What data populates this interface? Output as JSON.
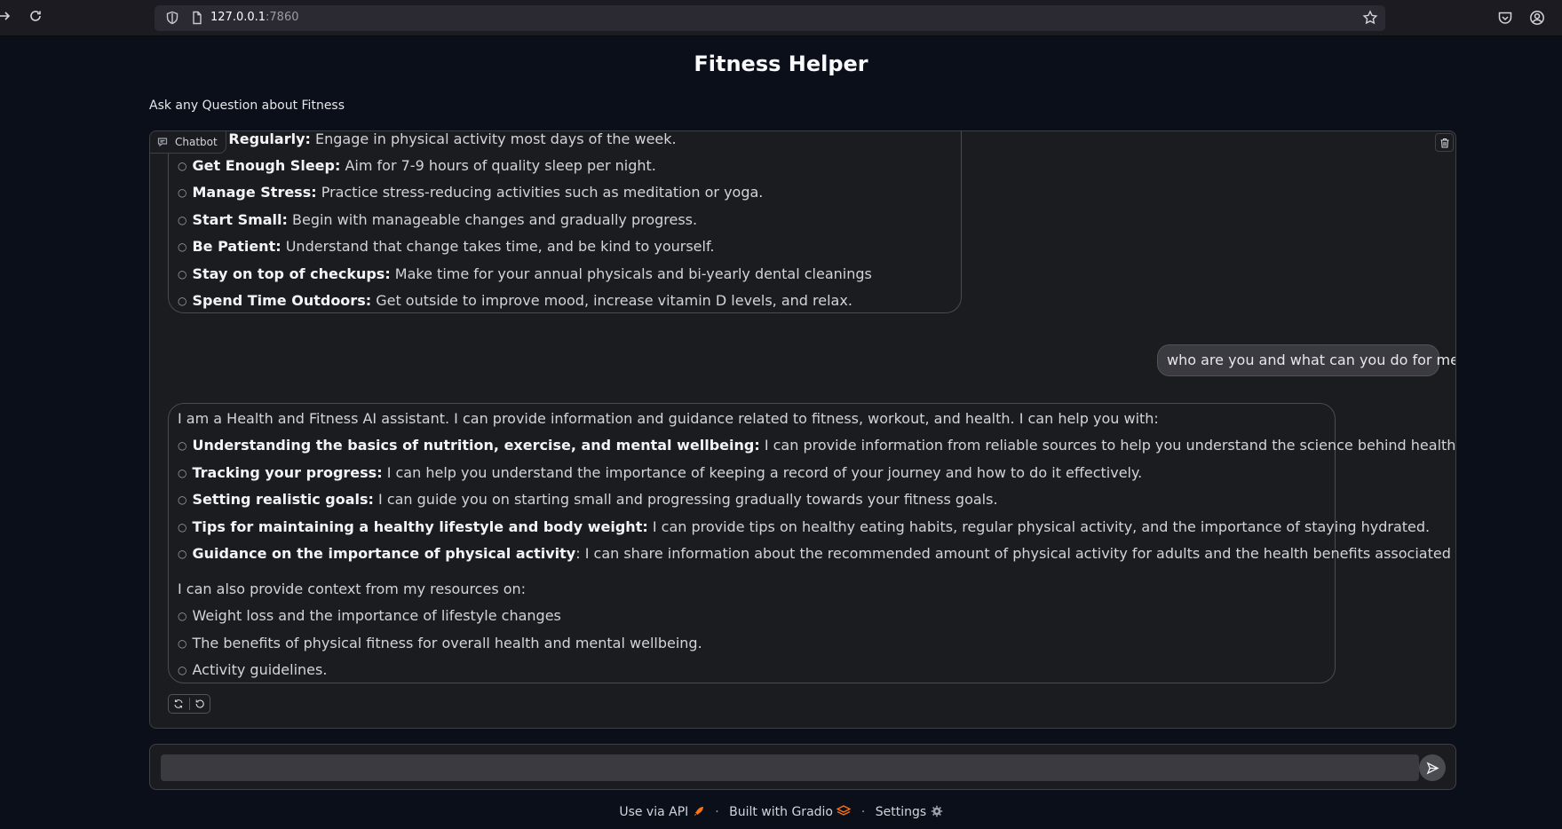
{
  "browser": {
    "url_host": "127.0.0.1",
    "url_port": ":7860"
  },
  "app": {
    "title": "Fitness Helper",
    "description": "Ask any Question about Fitness"
  },
  "chatbot": {
    "label": "Chatbot",
    "messages": [
      {
        "role": "bot",
        "items": [
          {
            "bold": "cise Regularly:",
            "text": " Engage in physical activity most days of the week."
          },
          {
            "bold": "Get Enough Sleep:",
            "text": " Aim for 7-9 hours of quality sleep per night."
          },
          {
            "bold": "Manage Stress:",
            "text": " Practice stress-reducing activities such as meditation or yoga."
          },
          {
            "bold": "Start Small:",
            "text": " Begin with manageable changes and gradually progress."
          },
          {
            "bold": "Be Patient:",
            "text": " Understand that change takes time, and be kind to yourself."
          },
          {
            "bold": "Stay on top of checkups:",
            "text": " Make time for your annual physicals and bi-yearly dental cleanings"
          },
          {
            "bold": "Spend Time Outdoors:",
            "text": " Get outside to improve mood, increase vitamin D levels, and relax."
          }
        ]
      },
      {
        "role": "user",
        "text": "who are you and what can you do for me?"
      },
      {
        "role": "bot",
        "intro": "I am a Health and Fitness AI assistant. I can provide information and guidance related to fitness, workout, and health. I can help you with:",
        "items": [
          {
            "bold": "Understanding the basics of nutrition, exercise, and mental wellbeing:",
            "text": " I can provide information from reliable sources to help you understand the science behind healthy living."
          },
          {
            "bold": "Tracking your progress:",
            "text": " I can help you understand the importance of keeping a record of your journey and how to do it effectively."
          },
          {
            "bold": "Setting realistic goals:",
            "text": " I can guide you on starting small and progressing gradually towards your fitness goals."
          },
          {
            "bold": "Tips for maintaining a healthy lifestyle and body weight:",
            "text": " I can provide tips on healthy eating habits, regular physical activity, and the importance of staying hydrated."
          },
          {
            "bold": "Guidance on the importance of physical activity",
            "text": ": I can share information about the recommended amount of physical activity for adults and the health benefits associated with it."
          }
        ],
        "outro": "I can also provide context from my resources on:",
        "items2": [
          {
            "text": "Weight loss and the importance of lifestyle changes"
          },
          {
            "text": "The benefits of physical fitness for overall health and mental wellbeing."
          },
          {
            "text": "Activity guidelines."
          }
        ]
      }
    ]
  },
  "input": {
    "value": "",
    "placeholder": ""
  },
  "footer": {
    "api_label": "Use via API",
    "built_label": "Built with Gradio",
    "settings_label": "Settings",
    "separator": "·"
  },
  "colors": {
    "background": "#0b0f19",
    "panel": "#1b1c20",
    "user_bubble": "#3a3a40",
    "accent_orange": "#f97316"
  }
}
